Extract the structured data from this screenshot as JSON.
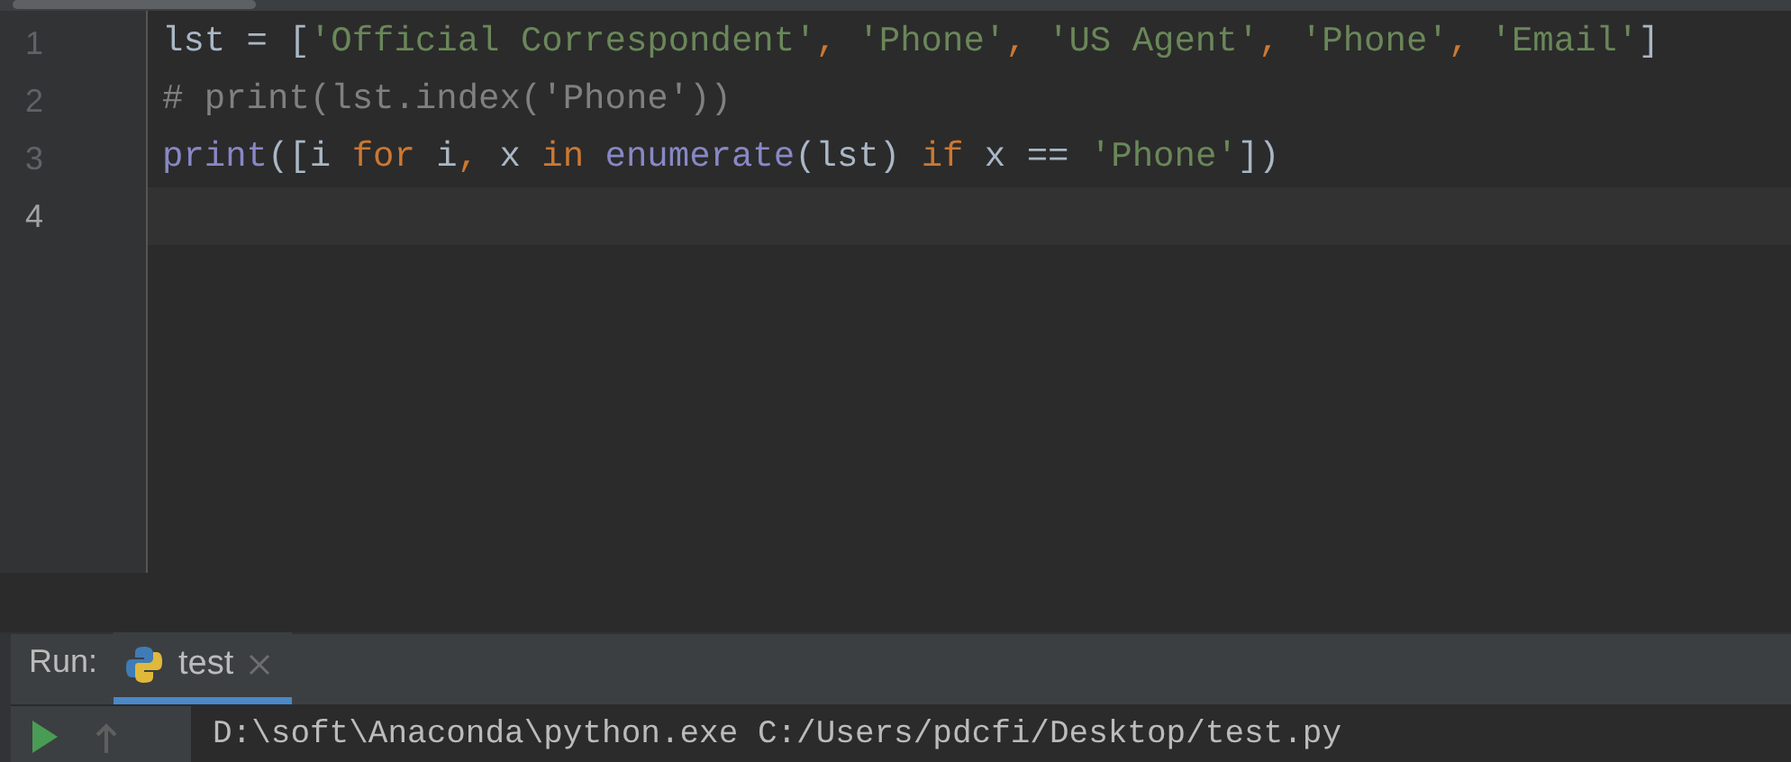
{
  "editor": {
    "lines": [
      {
        "number": "1",
        "current": false,
        "tokens": [
          {
            "text": "lst = [",
            "kind": "plain"
          },
          {
            "text": "'Official Correspondent'",
            "kind": "string"
          },
          {
            "text": ", ",
            "kind": "comma"
          },
          {
            "text": "'Phone'",
            "kind": "string"
          },
          {
            "text": ", ",
            "kind": "comma"
          },
          {
            "text": "'US Agent'",
            "kind": "string"
          },
          {
            "text": ", ",
            "kind": "comma"
          },
          {
            "text": "'Phone'",
            "kind": "string"
          },
          {
            "text": ", ",
            "kind": "comma"
          },
          {
            "text": "'Email'",
            "kind": "string"
          },
          {
            "text": "]",
            "kind": "plain"
          }
        ]
      },
      {
        "number": "2",
        "current": false,
        "tokens": [
          {
            "text": "# print(lst.index('Phone'))",
            "kind": "comment"
          }
        ]
      },
      {
        "number": "3",
        "current": false,
        "tokens": [
          {
            "text": "print",
            "kind": "builtin"
          },
          {
            "text": "([i ",
            "kind": "plain"
          },
          {
            "text": "for",
            "kind": "keyword"
          },
          {
            "text": " i",
            "kind": "plain"
          },
          {
            "text": ", ",
            "kind": "comma"
          },
          {
            "text": "x ",
            "kind": "plain"
          },
          {
            "text": "in ",
            "kind": "keyword"
          },
          {
            "text": "enumerate",
            "kind": "builtin"
          },
          {
            "text": "(lst) ",
            "kind": "plain"
          },
          {
            "text": "if",
            "kind": "keyword"
          },
          {
            "text": " x == ",
            "kind": "plain"
          },
          {
            "text": "'Phone'",
            "kind": "string"
          },
          {
            "text": "])",
            "kind": "plain"
          }
        ]
      },
      {
        "number": "4",
        "current": true
      }
    ]
  },
  "run_panel": {
    "label": "Run:",
    "tabs": [
      {
        "label": "test",
        "selected": true
      }
    ],
    "console": [
      "D:\\soft\\Anaconda\\python.exe C:/Users/pdcfi/Desktop/test.py"
    ]
  }
}
